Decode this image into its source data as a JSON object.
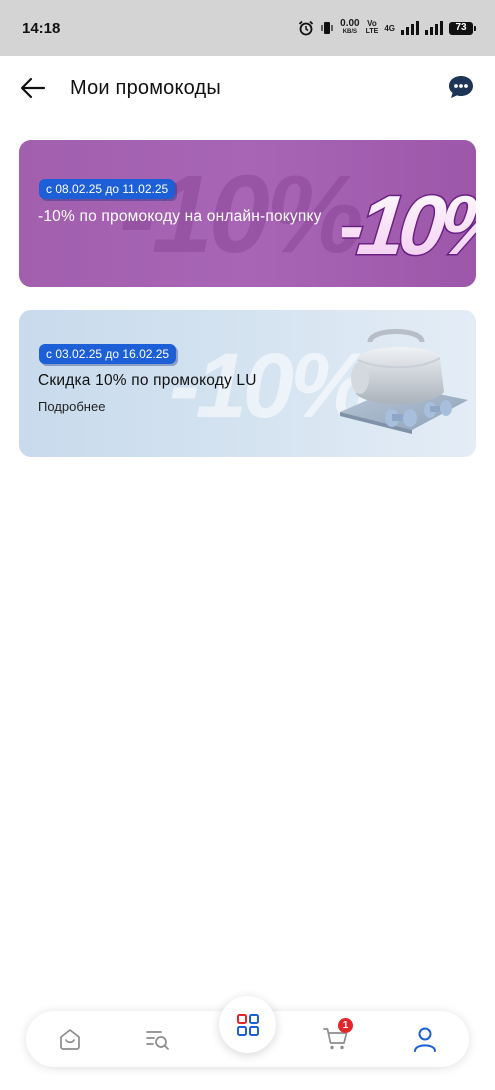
{
  "status_bar": {
    "time": "14:18",
    "speed_value": "0.00",
    "speed_unit": "KB/S",
    "volte_top": "Vo",
    "volte_bottom": "LTE",
    "network": "4G",
    "battery": "73"
  },
  "header": {
    "title": "Мои промокоды"
  },
  "promos": [
    {
      "date_range": "с 08.02.25 до 11.02.25",
      "title": "-10% по промокоду на онлайн-покупку",
      "watermark": "-10%",
      "art_text": "-10%",
      "accent": "#a865b5"
    },
    {
      "date_range": "с 03.02.25 до 16.02.25",
      "title": "Скидка 10% по промокоду LU",
      "link": "Подробнее",
      "watermark": "-10%",
      "accent": "#d6e4f1"
    }
  ],
  "bottom_nav": {
    "cart_badge": "1",
    "active_color": "#1d5fd6"
  }
}
